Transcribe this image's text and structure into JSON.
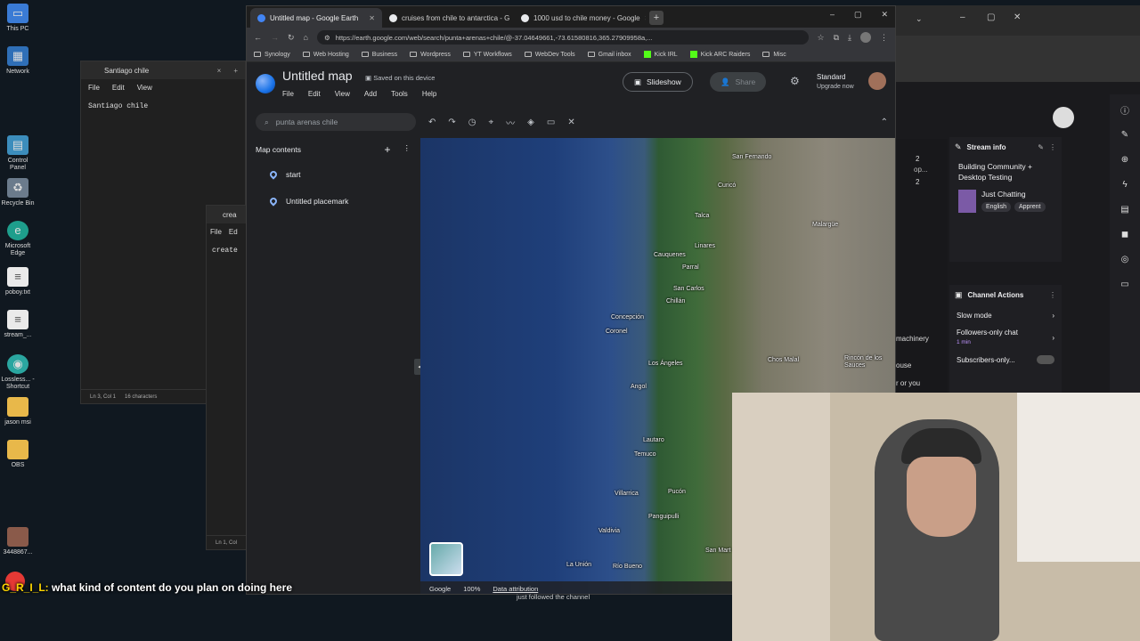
{
  "desktop": {
    "icons": [
      {
        "label": "This PC",
        "icon": "computer-icon"
      },
      {
        "label": "Network",
        "icon": "network-icon"
      },
      {
        "label": "Control Panel",
        "icon": "control-panel-icon"
      },
      {
        "label": "Recycle Bin",
        "icon": "recycle-bin-icon"
      },
      {
        "label": "Microsoft Edge",
        "icon": "edge-icon"
      },
      {
        "label": "poboy.txt",
        "icon": "text-file-icon"
      },
      {
        "label": "stream_...",
        "icon": "text-file-icon"
      },
      {
        "label": "Lossless... - Shortcut",
        "icon": "app-shortcut-icon"
      },
      {
        "label": "jason msi",
        "icon": "folder-icon"
      },
      {
        "label": "OBS",
        "icon": "folder-icon"
      },
      {
        "label": "3448867...",
        "icon": "image-file-icon"
      }
    ]
  },
  "notepad1": {
    "title": "Santiago chile",
    "menu": [
      "File",
      "Edit",
      "View"
    ],
    "content": "Santiago chile",
    "status_pos": "Ln 3, Col 1",
    "status_chars": "16 characters"
  },
  "notepad2": {
    "title": "crea",
    "menu": [
      "File",
      "Ed"
    ],
    "content": "create",
    "status_pos": "Ln 1, Col"
  },
  "chrome": {
    "tabs": [
      {
        "title": "Untitled map - Google Earth",
        "active": true
      },
      {
        "title": "cruises from chile to antarctica - G",
        "active": false
      },
      {
        "title": "1000 usd to chile money - Google",
        "active": false
      }
    ],
    "new_tab": "+",
    "url": "https://earth.google.com/web/search/punta+arenas+chile/@-37.04649661,-73.61580816,365.27909958a,...",
    "bookmarks": [
      "Synology",
      "Web Hosting",
      "Business",
      "Wordpress",
      "YT Workflows",
      "WebDev Tools",
      "Gmail inbox",
      "Kick IRL",
      "Kick ARC Raiders",
      "Misc"
    ]
  },
  "earth": {
    "title": "Untitled map",
    "saved_status": "Saved on this device",
    "menu": [
      "File",
      "Edit",
      "View",
      "Add",
      "Tools",
      "Help"
    ],
    "slideshow_label": "Slideshow",
    "share_label": "Share",
    "plan_label": "Standard",
    "upgrade_label": "Upgrade now",
    "search_value": "punta arenas chile",
    "panel_title": "Map contents",
    "items": [
      "start",
      "Untitled placemark"
    ],
    "footer": {
      "brand": "Google",
      "zoom": "100%",
      "data_attribution": "Data attribution"
    }
  },
  "map_labels": [
    {
      "name": "San Fernando"
    },
    {
      "name": "Curicó"
    },
    {
      "name": "Talca"
    },
    {
      "name": "Malargüe"
    },
    {
      "name": "Linares"
    },
    {
      "name": "Cauquenes"
    },
    {
      "name": "Parral"
    },
    {
      "name": "San Carlos"
    },
    {
      "name": "Chillán"
    },
    {
      "name": "Concepción"
    },
    {
      "name": "Coronel"
    },
    {
      "name": "Los Ángeles"
    },
    {
      "name": "Chos Malal"
    },
    {
      "name": "Rincón de los Sauces"
    },
    {
      "name": "Angol"
    },
    {
      "name": "Lautaro"
    },
    {
      "name": "Temuco"
    },
    {
      "name": "Villarrica"
    },
    {
      "name": "Pucón"
    },
    {
      "name": "Panguipulli"
    },
    {
      "name": "Valdivia"
    },
    {
      "name": "La Unión"
    },
    {
      "name": "Río Bueno"
    },
    {
      "name": "San Mart"
    }
  ],
  "stream": {
    "info_title": "Stream info",
    "stream_title": "Building Community + Desktop Testing",
    "category": "Just Chatting",
    "tags": [
      "English",
      "Apprent"
    ],
    "actions_title": "Channel Actions",
    "actions": [
      {
        "label": "Slow mode",
        "sub": ""
      },
      {
        "label": "Followers-only chat",
        "sub": "1 min"
      },
      {
        "label": "Subscribers-only...",
        "sub": ""
      }
    ],
    "side_snippets": [
      "machinery",
      "ouse",
      "r or you"
    ],
    "counts": [
      "2",
      "2"
    ],
    "count_labels": [
      "op..."
    ]
  },
  "chat_overlay": {
    "user": "G_R_I_L:",
    "message": "what kind of content do you plan on doing here"
  },
  "follow_alert": "just followed the channel",
  "colors": {
    "accent": "#8ab4f8",
    "twitch_green": "#00c853",
    "alert_red": "#e53935"
  }
}
